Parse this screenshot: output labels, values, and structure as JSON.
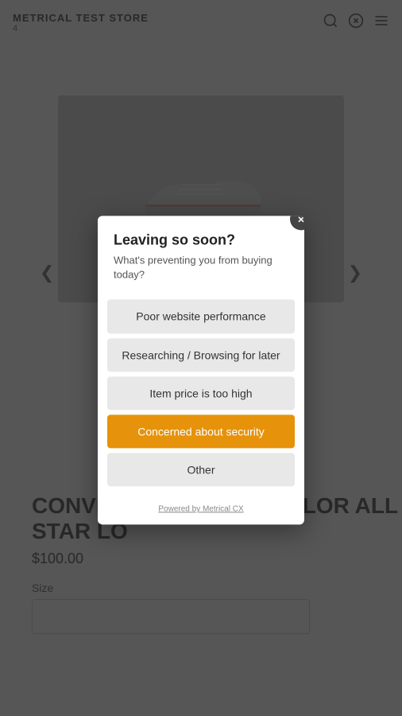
{
  "store": {
    "title": "METRICAL TEST STORE",
    "subtitle": "4",
    "product_name": "CONVERSE | CHUCK TAYLOR ALL STAR LO",
    "price": "$100.00",
    "size_label": "Size"
  },
  "modal": {
    "title": "Leaving so soon?",
    "subtitle": "What's preventing you from buying today?",
    "close_icon": "×",
    "options": [
      {
        "label": "Poor website performance",
        "active": false
      },
      {
        "label": "Researching / Browsing for later",
        "active": false
      },
      {
        "label": "Item price is too high",
        "active": false
      },
      {
        "label": "Concerned about security",
        "active": true
      },
      {
        "label": "Other",
        "active": false
      }
    ],
    "powered_by": "Powered by Metrical CX"
  },
  "nav": {
    "left_arrow": "❮",
    "right_arrow": "❯"
  }
}
